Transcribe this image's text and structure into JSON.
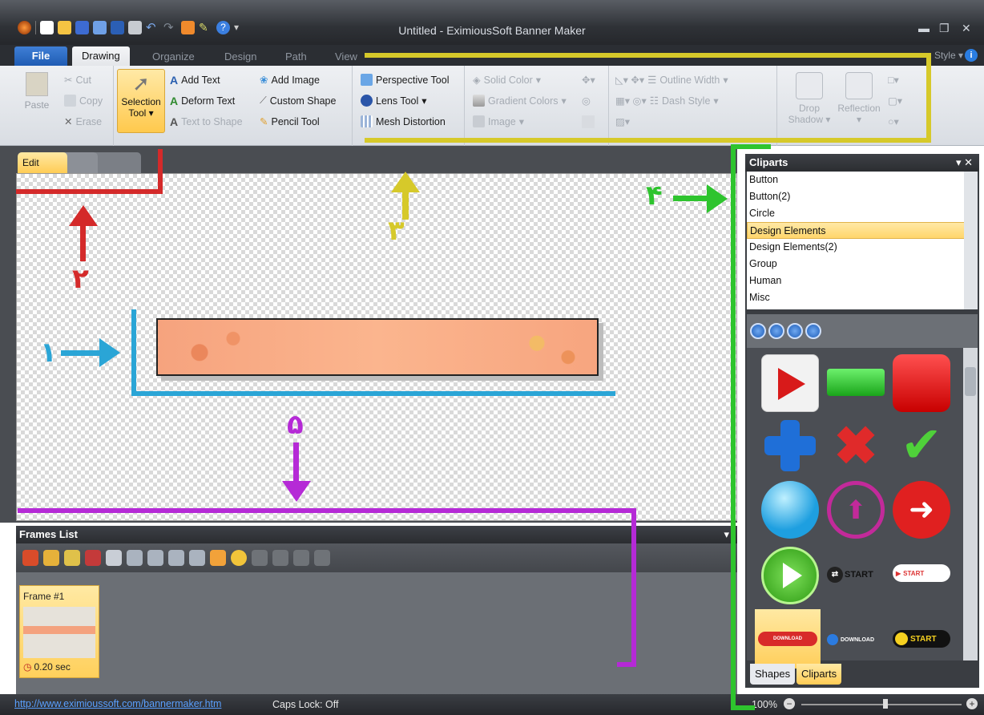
{
  "window": {
    "title": "Untitled - EximiousSoft Banner Maker"
  },
  "ribbon_tabs": {
    "file": "File",
    "drawing": "Drawing",
    "organize": "Organize",
    "design": "Design",
    "path": "Path",
    "view": "View",
    "style": "Style"
  },
  "ribbon": {
    "paste": "Paste",
    "cut": "Cut",
    "copy": "Copy",
    "erase": "Erase",
    "selection_tool": "Selection",
    "selection_tool2": "Tool",
    "add_text": "Add Text",
    "deform_text": "Deform Text",
    "text_to_shape": "Text to Shape",
    "add_image": "Add Image",
    "custom_shape": "Custom Shape",
    "pencil_tool": "Pencil Tool",
    "perspective_tool": "Perspective Tool",
    "lens_tool": "Lens Tool",
    "mesh_distortion": "Mesh Distortion",
    "solid_color": "Solid Color",
    "gradient_colors": "Gradient Colors",
    "image": "Image",
    "outline_width": "Outline Width",
    "dash_style": "Dash Style",
    "drop_shadow": "Drop",
    "drop_shadow2": "Shadow",
    "reflection": "Reflection"
  },
  "doc_tabs": {
    "edit": "Edit"
  },
  "frames": {
    "title": "Frames List",
    "frame_label": "Frame #1",
    "frame_time": "0.20 sec"
  },
  "cliparts": {
    "title": "Cliparts",
    "categories": [
      "Button",
      "Button(2)",
      "Circle",
      "Design Elements",
      "Design Elements(2)",
      "Group",
      "Human",
      "Misc"
    ],
    "selected": "Design Elements",
    "clip_texts": {
      "start1": "START",
      "start2": "START",
      "download1": "DOWNLOAD",
      "download2": "DOWNLOAD",
      "start3": "START"
    },
    "tabs": {
      "shapes": "Shapes",
      "cliparts": "Cliparts"
    }
  },
  "status": {
    "link": "http://www.eximioussoft.com/bannermaker.htm",
    "caps": "Caps Lock: Off",
    "zoom": "100%"
  },
  "annotations": {
    "n1": "۱",
    "n2": "۲",
    "n3": "۳",
    "n4": "۴",
    "n5": "۵"
  },
  "colors": {
    "red": "#d42a2a",
    "blue": "#2aa5d6",
    "yellow": "#d6c92a",
    "green": "#2ec42e",
    "purple": "#b52ad6"
  }
}
